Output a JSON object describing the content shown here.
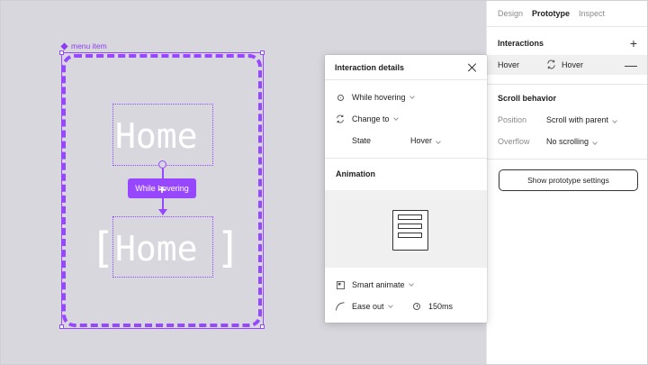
{
  "canvas": {
    "component_label": "menu item",
    "home_text": "Home",
    "home_hover_text": "Home",
    "bracket_left": "[",
    "bracket_right": "]",
    "trigger_pill": "While hovering"
  },
  "right_panel": {
    "tabs": [
      "Design",
      "Prototype",
      "Inspect"
    ],
    "active_tab": "Prototype",
    "interactions": {
      "title": "Interactions",
      "add_icon": "plus-icon",
      "row": {
        "trigger": "Hover",
        "icon": "swap-icon",
        "action": "Hover",
        "remove_icon": "minus-icon"
      }
    },
    "scroll_behavior": {
      "title": "Scroll behavior",
      "position_label": "Position",
      "position_value": "Scroll with parent",
      "overflow_label": "Overflow",
      "overflow_value": "No scrolling"
    },
    "settings_button": "Show prototype settings"
  },
  "modal": {
    "title": "Interaction details",
    "trigger": "While hovering",
    "action": "Change to",
    "state_label": "State",
    "state_value": "Hover",
    "animation_title": "Animation",
    "animation_type": "Smart animate",
    "easing": "Ease out",
    "duration": "150ms"
  },
  "colors": {
    "accent": "#9747ff",
    "canvas": "#d9d7de",
    "text": "#1e1e1e",
    "muted": "#8a8a8a"
  }
}
